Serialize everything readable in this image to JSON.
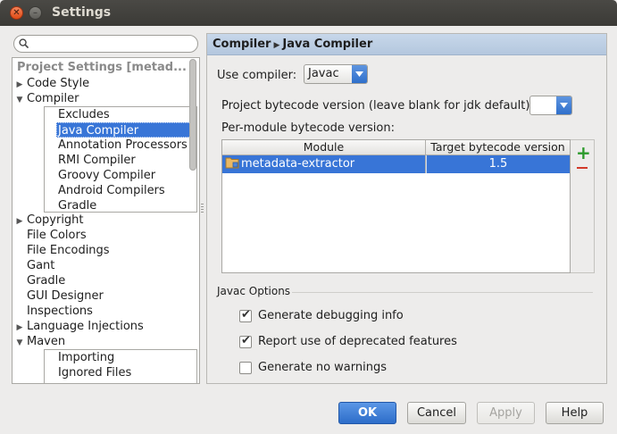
{
  "window": {
    "title": "Settings"
  },
  "search": {
    "placeholder": "",
    "value": ""
  },
  "tree": {
    "section_header": "Project Settings [metad...",
    "items": [
      {
        "label": "Code Style",
        "expander": "collapsed"
      },
      {
        "label": "Compiler",
        "expander": "expanded"
      },
      {
        "label": "Copyright",
        "expander": "collapsed"
      },
      {
        "label": "File Colors"
      },
      {
        "label": "File Encodings"
      },
      {
        "label": "Gant"
      },
      {
        "label": "Gradle"
      },
      {
        "label": "GUI Designer"
      },
      {
        "label": "Inspections"
      },
      {
        "label": "Language Injections",
        "expander": "collapsed"
      },
      {
        "label": "Maven",
        "expander": "expanded"
      }
    ],
    "compiler_children": [
      "Excludes",
      "Java Compiler",
      "Annotation Processors",
      "RMI Compiler",
      "Groovy Compiler",
      "Android Compilers",
      "Gradle"
    ],
    "maven_children": [
      "Importing",
      "Ignored Files"
    ],
    "selected": "Java Compiler"
  },
  "panel": {
    "breadcrumb": [
      "Compiler",
      "Java Compiler"
    ],
    "use_compiler_label": "Use compiler:",
    "use_compiler_value": "Javac",
    "bytecode_label": "Project bytecode version (leave blank for jdk default):",
    "bytecode_value": "",
    "per_module_label": "Per-module bytecode version:",
    "table": {
      "columns": [
        "Module",
        "Target bytecode version"
      ],
      "rows": [
        {
          "module": "metadata-extractor",
          "version": "1.5"
        }
      ]
    },
    "javac_options_title": "Javac Options",
    "options": [
      {
        "label": "Generate debugging info",
        "checked": true
      },
      {
        "label": "Report use of deprecated features",
        "checked": true
      },
      {
        "label": "Generate no warnings",
        "checked": false
      }
    ]
  },
  "buttons": {
    "ok": "OK",
    "cancel": "Cancel",
    "apply": "Apply",
    "help": "Help"
  },
  "colors": {
    "selection": "#3875d7",
    "header": "#b9cbe1",
    "add": "#2b9a2b",
    "remove": "#d23a2a"
  }
}
